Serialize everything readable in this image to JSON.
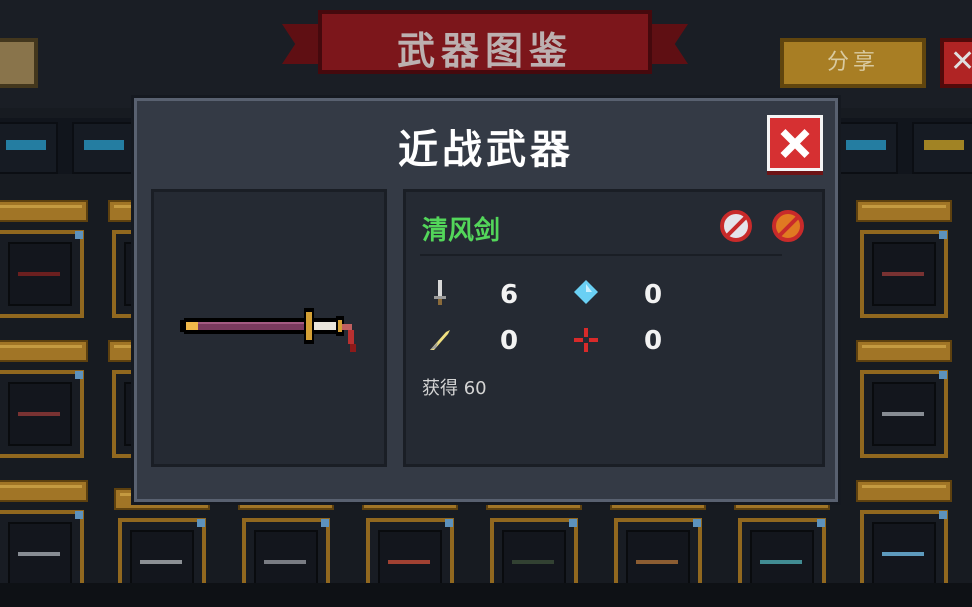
{
  "header": {
    "title": "武器图鉴",
    "share_label": "分享"
  },
  "modal": {
    "title": "近战武器",
    "weapon": {
      "name": "清风剑",
      "stats": [
        {
          "icon": "damage-icon",
          "value": "6"
        },
        {
          "icon": "energy-icon",
          "value": "0"
        },
        {
          "icon": "crit-icon",
          "value": "0"
        },
        {
          "icon": "accuracy-icon",
          "value": "0"
        }
      ],
      "obtain_label": "获得",
      "obtain_value": "60"
    }
  },
  "colors": {
    "name_green": "#53d65a",
    "close_red": "#d63032",
    "banner_red": "#8e1a1f",
    "gold": "#c0902a"
  }
}
